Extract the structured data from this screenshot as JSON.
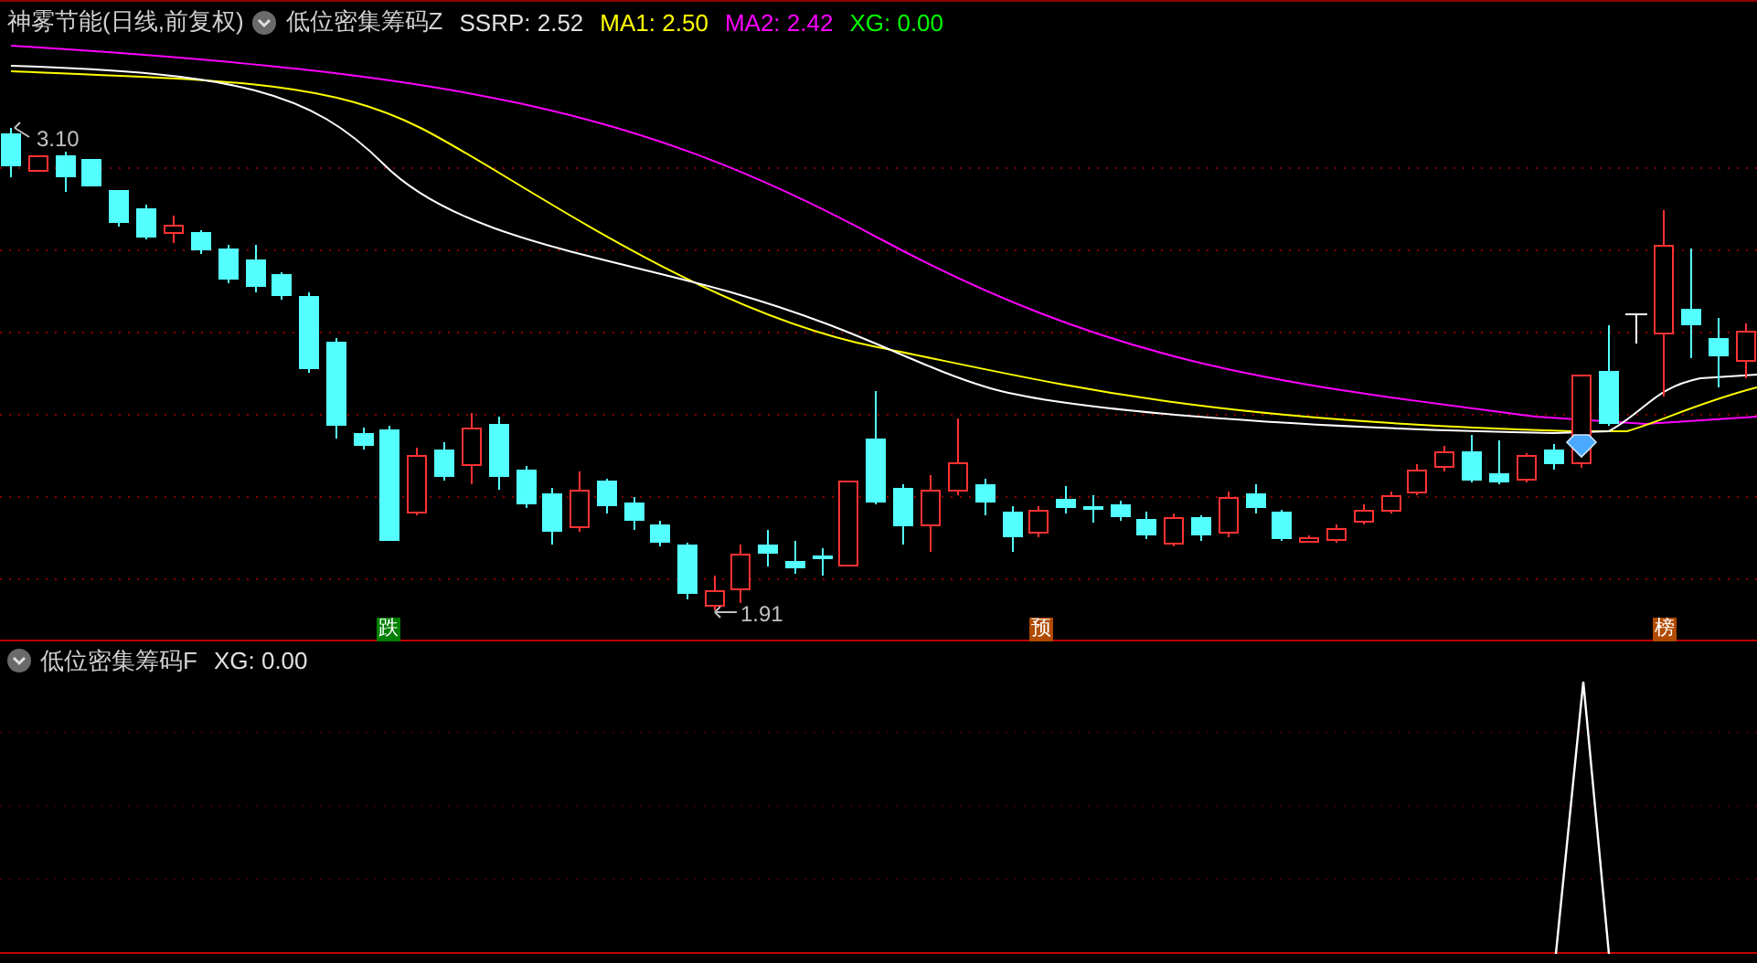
{
  "price_pane": {
    "header": {
      "stock": "神雾节能(日线,前复权)",
      "indicator": "低位密集筹码Z",
      "values": [
        {
          "label": "SSRP: 2.52",
          "color": "#e0e0e0"
        },
        {
          "label": "MA1: 2.50",
          "color": "#ffff00"
        },
        {
          "label": "MA2: 2.42",
          "color": "#ff00ff"
        },
        {
          "label": "XG: 0.00",
          "color": "#00ff00"
        }
      ]
    },
    "high_label": "3.10",
    "low_label": "1.91",
    "signals": [
      {
        "text": "跌",
        "color": "#007f00"
      },
      {
        "text": "预",
        "color": "#b04a00"
      },
      {
        "text": "榜",
        "color": "#b04a00"
      }
    ]
  },
  "indicator_pane": {
    "header": {
      "indicator": "低位密集筹码F",
      "values": [
        {
          "label": "XG: 0.00",
          "color": "#e0e0e0"
        }
      ]
    }
  }
}
